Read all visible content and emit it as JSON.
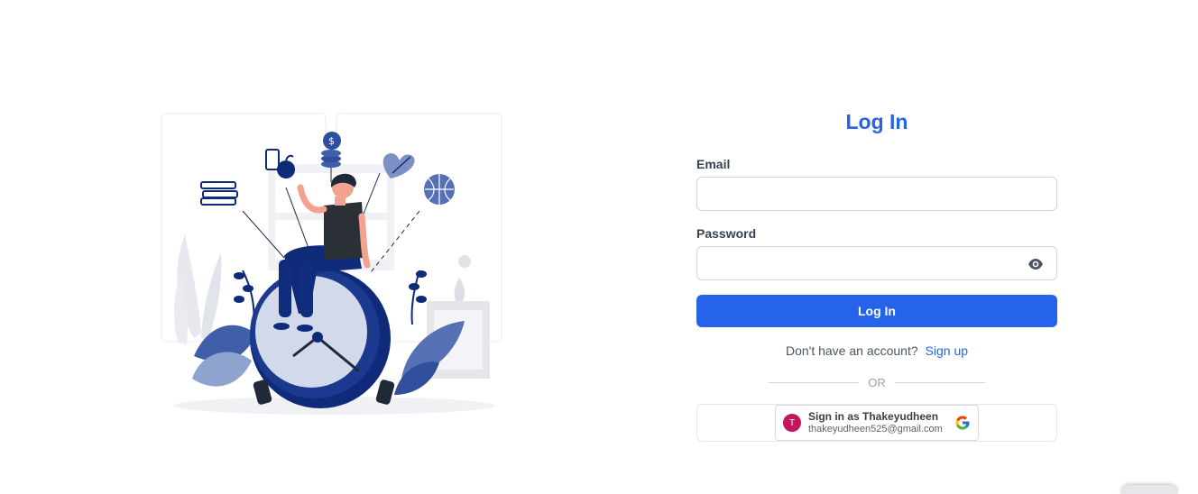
{
  "login": {
    "title": "Log In",
    "email_label": "Email",
    "email_value": "",
    "password_label": "Password",
    "password_value": "",
    "submit_label": "Log In",
    "no_account_text": "Don't have an account?",
    "signup_link": "Sign up",
    "or_text": "OR"
  },
  "google": {
    "avatar_initial": "T",
    "signin_text": "Sign in as Thakeyudheen",
    "email": "thakeyudheen525@gmail.com",
    "icon": "google-g-icon"
  },
  "icons": {
    "password_toggle": "eye-icon"
  },
  "colors": {
    "accent": "#2563eb",
    "illustration_navy": "#0f2a78",
    "avatar": "#c2185b"
  }
}
